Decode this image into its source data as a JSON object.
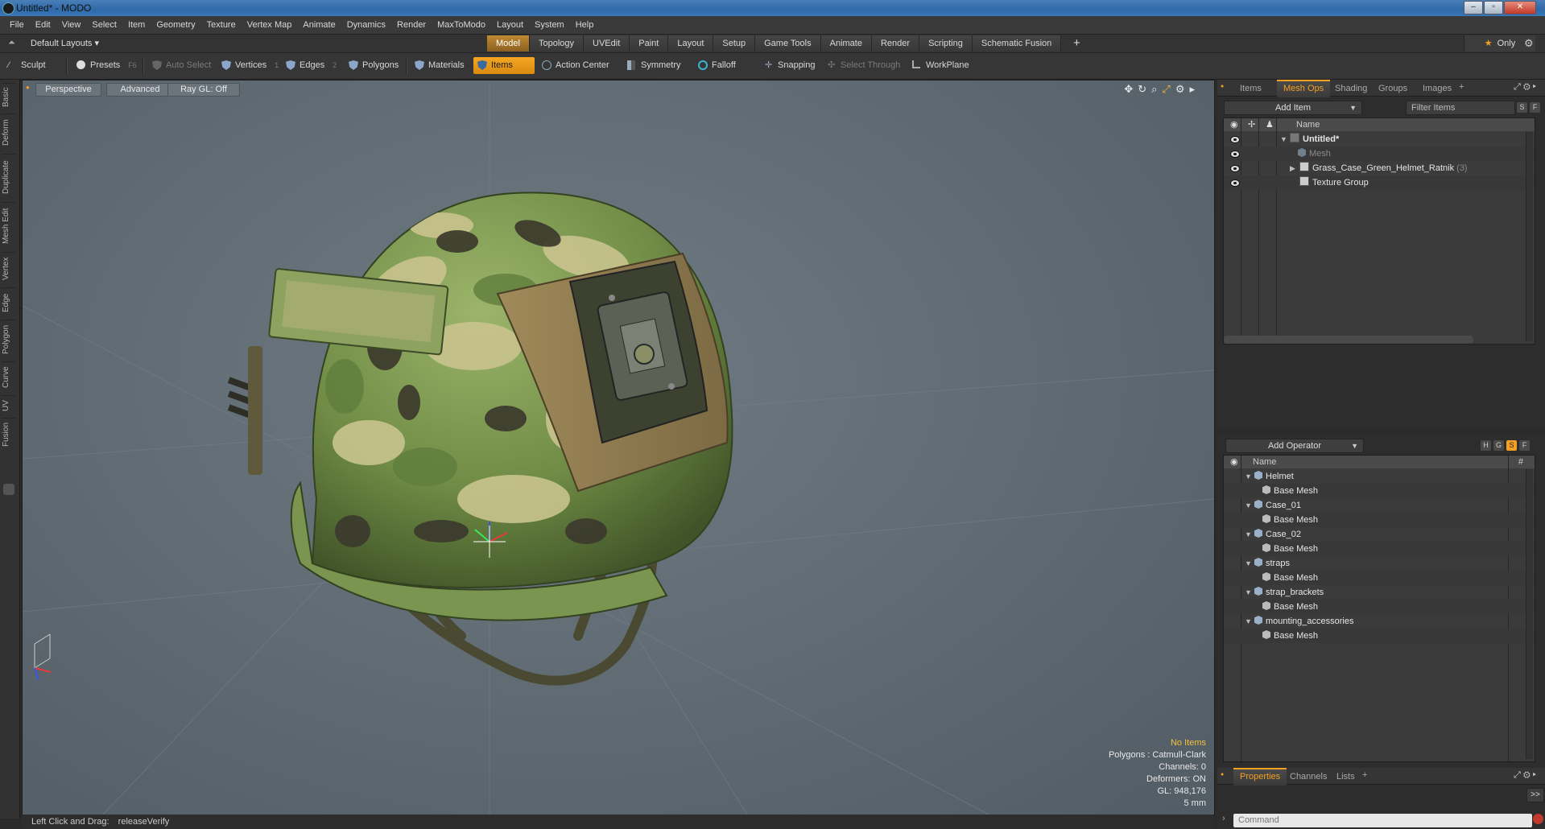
{
  "window": {
    "title": "Untitled* - MODO",
    "minimize": "‒",
    "maximize": "▫",
    "close": "✕"
  },
  "menu": [
    "File",
    "Edit",
    "View",
    "Select",
    "Item",
    "Geometry",
    "Texture",
    "Vertex Map",
    "Animate",
    "Dynamics",
    "Render",
    "MaxToModo",
    "Layout",
    "System",
    "Help"
  ],
  "layouts": {
    "label": "Default Layouts ▾",
    "tabs": [
      "Model",
      "Topology",
      "UVEdit",
      "Paint",
      "Layout",
      "Setup",
      "Game Tools",
      "Animate",
      "Render",
      "Scripting",
      "Schematic Fusion"
    ],
    "active": "Model",
    "add": "+",
    "only": "Only"
  },
  "toolbar": {
    "sculpt": "Sculpt",
    "presets": "Presets",
    "presets_key": "F6",
    "auto_select": "Auto Select",
    "vertices": "Vertices",
    "vertices_num": "1",
    "edges": "Edges",
    "edges_num": "2",
    "polygons": "Polygons",
    "materials": "Materials",
    "items": "Items",
    "action_center": "Action Center",
    "symmetry": "Symmetry",
    "falloff": "Falloff",
    "snapping": "Snapping",
    "select_through": "Select Through",
    "workplane": "WorkPlane"
  },
  "left_tabs": [
    "Basic",
    "Deform",
    "Duplicate",
    "Mesh Edit",
    "Vertex",
    "Edge",
    "Polygon",
    "Curve",
    "UV",
    "Fusion"
  ],
  "viewport": {
    "view": "Perspective",
    "shading": "Advanced",
    "raygl": "Ray GL: Off",
    "hud": {
      "selection": "No Items",
      "polygons": "Polygons : Catmull-Clark",
      "channels": "Channels: 0",
      "deformers": "Deformers: ON",
      "gl": "GL: 948,176",
      "scale": "5 mm"
    }
  },
  "status": {
    "hint": "Left Click and Drag:",
    "action": "releaseVerify"
  },
  "items_panel": {
    "tabs": [
      "Items",
      "Mesh Ops",
      "Shading",
      "Groups",
      "Images"
    ],
    "active": "Mesh Ops",
    "add_item": "Add Item",
    "filter": "Filter Items",
    "s": "S",
    "f": "F",
    "col_name": "Name",
    "rows": [
      {
        "name": "Untitled*"
      },
      {
        "name": "Mesh"
      },
      {
        "name": "Grass_Case_Green_Helmet_Ratnik",
        "count": "(3)"
      },
      {
        "name": "Texture Group"
      }
    ]
  },
  "meshops_panel": {
    "add_operator": "Add Operator",
    "h": "H",
    "g": "G",
    "s": "S",
    "f": "F",
    "col_name": "Name",
    "col_hash": "#",
    "rows": [
      {
        "name": "Helmet",
        "child": "Base Mesh"
      },
      {
        "name": "Case_01",
        "child": "Base Mesh"
      },
      {
        "name": "Case_02",
        "child": "Base Mesh"
      },
      {
        "name": "straps",
        "child": "Base Mesh"
      },
      {
        "name": "strap_brackets",
        "child": "Base Mesh"
      },
      {
        "name": "mounting_accessories",
        "child": "Base Mesh"
      }
    ]
  },
  "bottom_panel": {
    "tabs": [
      "Properties",
      "Channels",
      "Lists"
    ],
    "active": "Properties",
    "more": ">>",
    "command_placeholder": "Command"
  },
  "colors": {
    "accent": "#f3a023",
    "camo_base": "#7d9a4f",
    "camo_light": "#c9c48e",
    "camo_dark": "#3b3a2c",
    "camo_mid": "#5f7d3c"
  }
}
